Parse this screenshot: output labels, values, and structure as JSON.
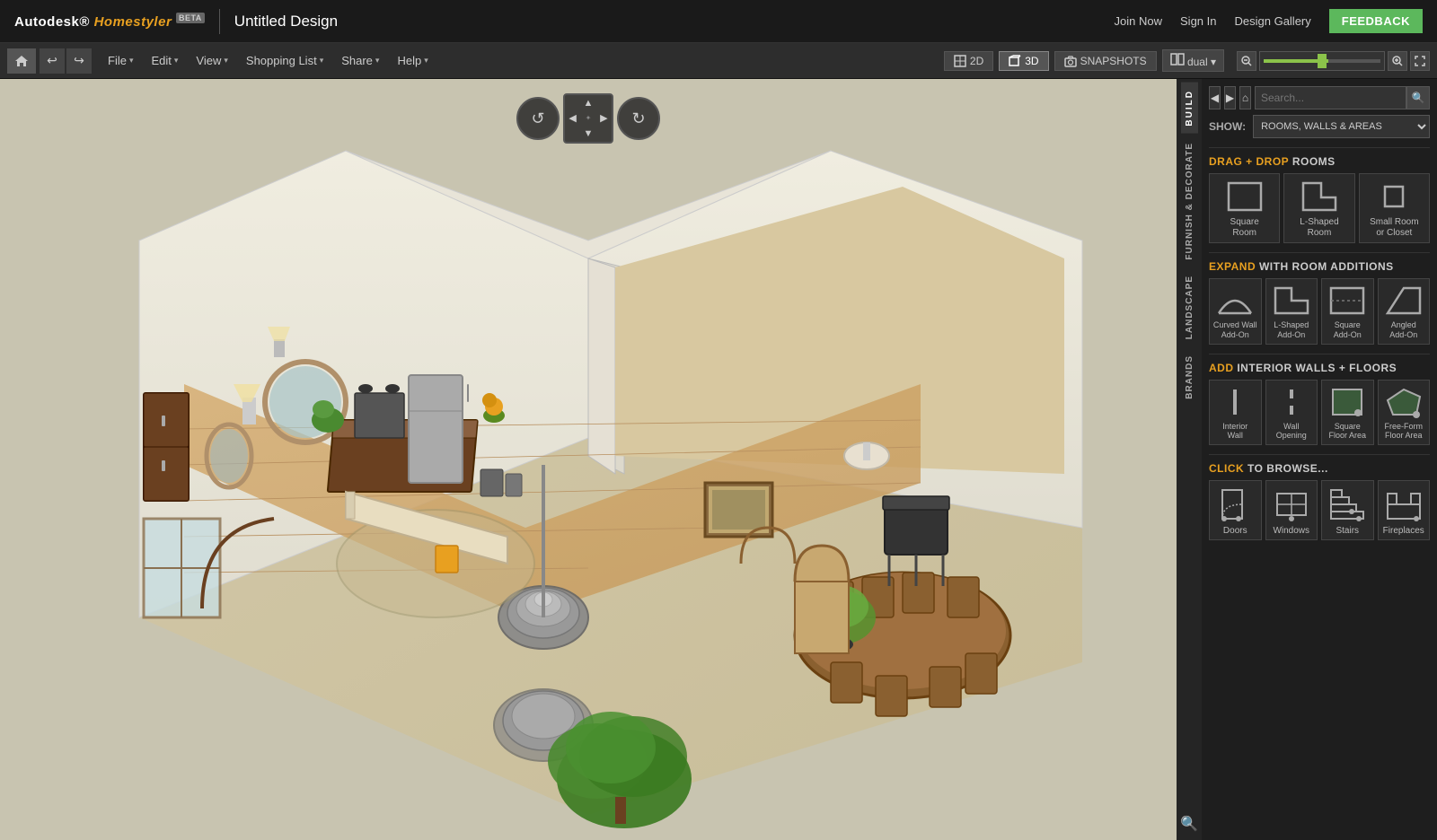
{
  "app": {
    "name": "Autodesk",
    "product": "Homestyler",
    "beta_label": "BETA",
    "title": "Untitled Design"
  },
  "top_nav": {
    "join_now": "Join Now",
    "sign_in": "Sign In",
    "design_gallery": "Design Gallery",
    "feedback": "FEEDBACK"
  },
  "menu": {
    "file": "File",
    "edit": "Edit",
    "view": "View",
    "shopping_list": "Shopping List",
    "share": "Share",
    "help": "Help"
  },
  "view_controls": {
    "btn_2d": "2D",
    "btn_3d": "3D",
    "snapshots": "SNAPSHOTS",
    "dual": "dual"
  },
  "panel": {
    "show_label": "SHOW:",
    "show_value": "ROOMS, WALLS & AREAS",
    "build_tab": "BUILD",
    "furnish_decorate_tab": "FURNISH & DECORATE",
    "landscape_tab": "LANDSCAPE",
    "brands_tab": "BRANDS"
  },
  "sections": {
    "drag_drop": {
      "header_plain": "DRAG + DROP",
      "header_highlight": "DRAG + DROP",
      "header_rest": "ROOMS",
      "items": [
        {
          "label": "Square\nRoom",
          "shape": "square"
        },
        {
          "label": "L-Shaped\nRoom",
          "shape": "lshape"
        },
        {
          "label": "Small Room\nor Closet",
          "shape": "small-square"
        }
      ]
    },
    "expand": {
      "header_highlight": "EXPAND",
      "header_rest": "WITH ROOM ADDITIONS",
      "items": [
        {
          "label": "Curved Wall\nAdd-On",
          "shape": "curved-wall"
        },
        {
          "label": "L-Shaped\nAdd-On",
          "shape": "l-add"
        },
        {
          "label": "Square\nAdd-On",
          "shape": "sq-add"
        },
        {
          "label": "Angled\nAdd-On",
          "shape": "angled-add"
        }
      ]
    },
    "interior": {
      "header_highlight": "ADD",
      "header_rest": "INTERIOR WALLS + FLOORS",
      "items": [
        {
          "label": "Interior\nWall",
          "shape": "int-wall"
        },
        {
          "label": "Wall\nOpening",
          "shape": "wall-opening"
        },
        {
          "label": "Square\nFloor Area",
          "shape": "sq-floor"
        },
        {
          "label": "Free-Form\nFloor Area",
          "shape": "ff-floor"
        }
      ]
    },
    "browse": {
      "header_plain": "CLICK",
      "header_rest": "TO BROWSE...",
      "items": [
        {
          "label": "Doors",
          "shape": "door"
        },
        {
          "label": "Windows",
          "shape": "window"
        },
        {
          "label": "Stairs",
          "shape": "stairs"
        },
        {
          "label": "Fireplaces",
          "shape": "fireplace"
        }
      ]
    }
  },
  "colors": {
    "accent": "#e8a020",
    "bg_dark": "#1a1a1a",
    "bg_medium": "#252525",
    "text_light": "#cccccc",
    "green_active": "#5cb85c",
    "zoom_green": "#8bc34a"
  }
}
